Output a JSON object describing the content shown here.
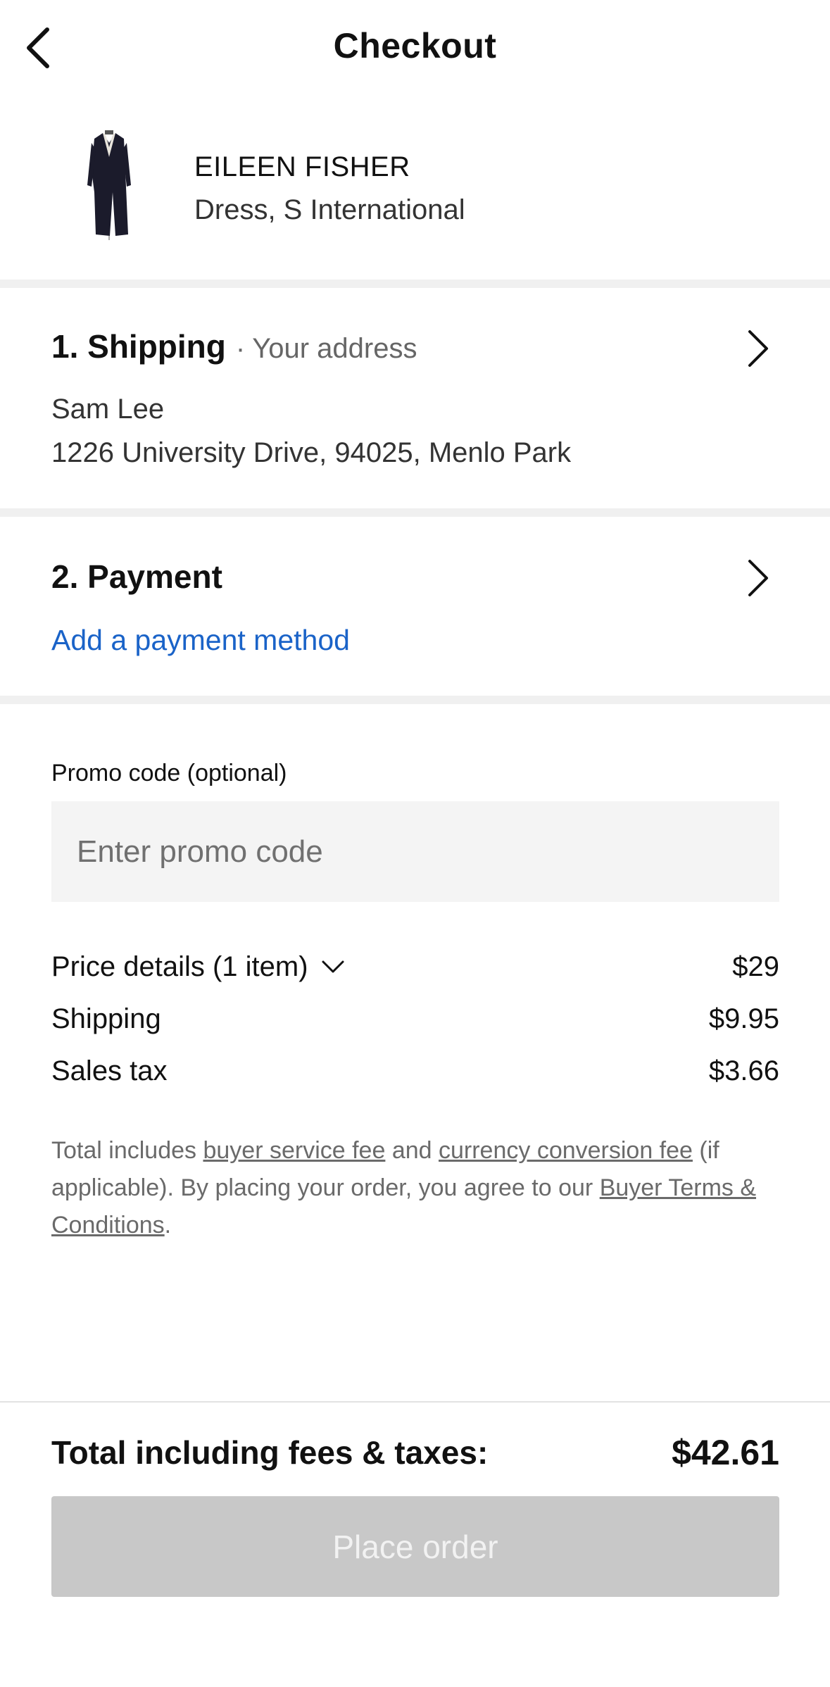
{
  "header": {
    "title": "Checkout",
    "back_icon": "chevron-left-icon"
  },
  "product": {
    "brand": "EILEEN FISHER",
    "description": "Dress, S International"
  },
  "shipping": {
    "heading": "1. Shipping",
    "subheading": "Your address",
    "name": "Sam Lee",
    "address": "1226 University Drive, 94025, Menlo Park"
  },
  "payment": {
    "heading": "2. Payment",
    "add_link": "Add a payment method"
  },
  "promo": {
    "label": "Promo code (optional)",
    "placeholder": "Enter promo code",
    "value": ""
  },
  "price_details": {
    "label": "Price details (1 item)",
    "amount": "$29",
    "shipping_label": "Shipping",
    "shipping_amount": "$9.95",
    "tax_label": "Sales tax",
    "tax_amount": "$3.66"
  },
  "terms": {
    "prefix": "Total includes ",
    "link1": "buyer service fee",
    "middle": " and ",
    "link2": "currency conversion fee",
    "middle2": " (if applicable). By placing your order, you agree to our ",
    "link3": "Buyer Terms & Conditions",
    "suffix": "."
  },
  "footer": {
    "total_label": "Total including fees & taxes:",
    "total_value": "$42.61",
    "place_order": "Place order"
  },
  "colors": {
    "link_blue": "#1a63c8",
    "divider": "#f0f0f0",
    "disabled_button": "#c8c8c8"
  }
}
